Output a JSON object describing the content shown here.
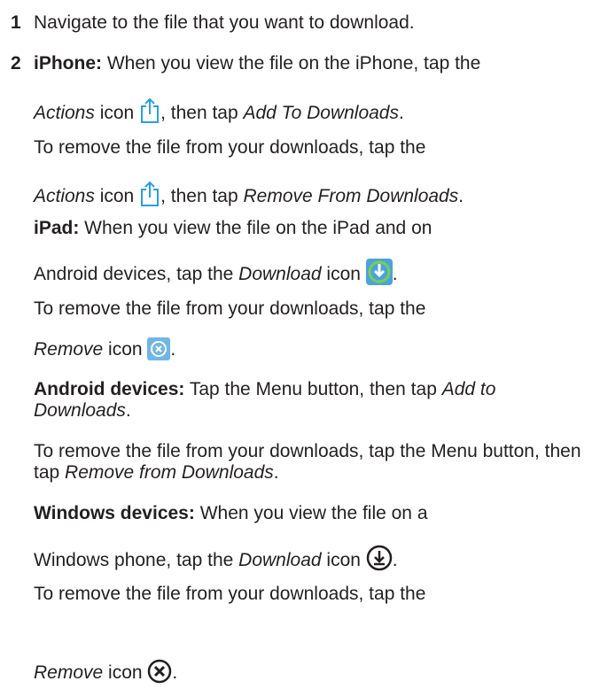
{
  "step1": {
    "number": "1",
    "text": "Navigate to the file that you want to download."
  },
  "step2": {
    "number": "2",
    "iphone": {
      "label": "iPhone:",
      "line1": " When you view the file on the iPhone, tap the",
      "add_actions": "Actions",
      "add_icon_word": " icon ",
      "add_then": ", then tap ",
      "add_action": "Add To Downloads",
      "add_end": ".",
      "remove_intro": "To remove the file from your downloads, tap the",
      "remove_actions": "Actions",
      "remove_icon_word": " icon ",
      "remove_then": ", then tap ",
      "remove_action": "Remove From Downloads",
      "remove_end": "."
    },
    "ipad": {
      "label": "iPad:",
      "line1": " When you view the file on the iPad and on",
      "line2": "Android devices, tap the ",
      "download": "Download",
      "download_icon_word": " icon ",
      "download_end": ".",
      "remove_intro": "To remove the file from your downloads, tap the",
      "remove": "Remove",
      "remove_icon_word": " icon ",
      "remove_end": "."
    },
    "android": {
      "label": "Android devices:",
      "line1": " Tap the Menu button, then tap ",
      "add_action": "Add to Downloads",
      "add_end": ".",
      "remove_text": "To remove the file from your downloads, tap the Menu button, then tap ",
      "remove_action": "Remove from Downloads",
      "remove_end": "."
    },
    "windows": {
      "label": "Windows devices:",
      "line1": " When you view the file on a",
      "line2": "Windows phone, tap the ",
      "download": "Download",
      "download_icon_word": " icon ",
      "download_end": ".",
      "remove_intro": "To remove the file from your downloads, tap the",
      "remove": "Remove",
      "remove_icon_word": " icon ",
      "remove_end": "."
    }
  },
  "icons": {
    "actions": "share-icon",
    "download": "download-circle-icon",
    "remove": "remove-circle-icon",
    "windows_download": "windows-download-icon",
    "windows_remove": "windows-remove-icon"
  },
  "colors": {
    "text": "#231f20",
    "ios_blue": "#2a9fe0",
    "ipad_download_bg": "#4aa3df",
    "ipad_download_fg": "#7ad04a",
    "ipad_remove_bg": "#6fb6e6"
  }
}
